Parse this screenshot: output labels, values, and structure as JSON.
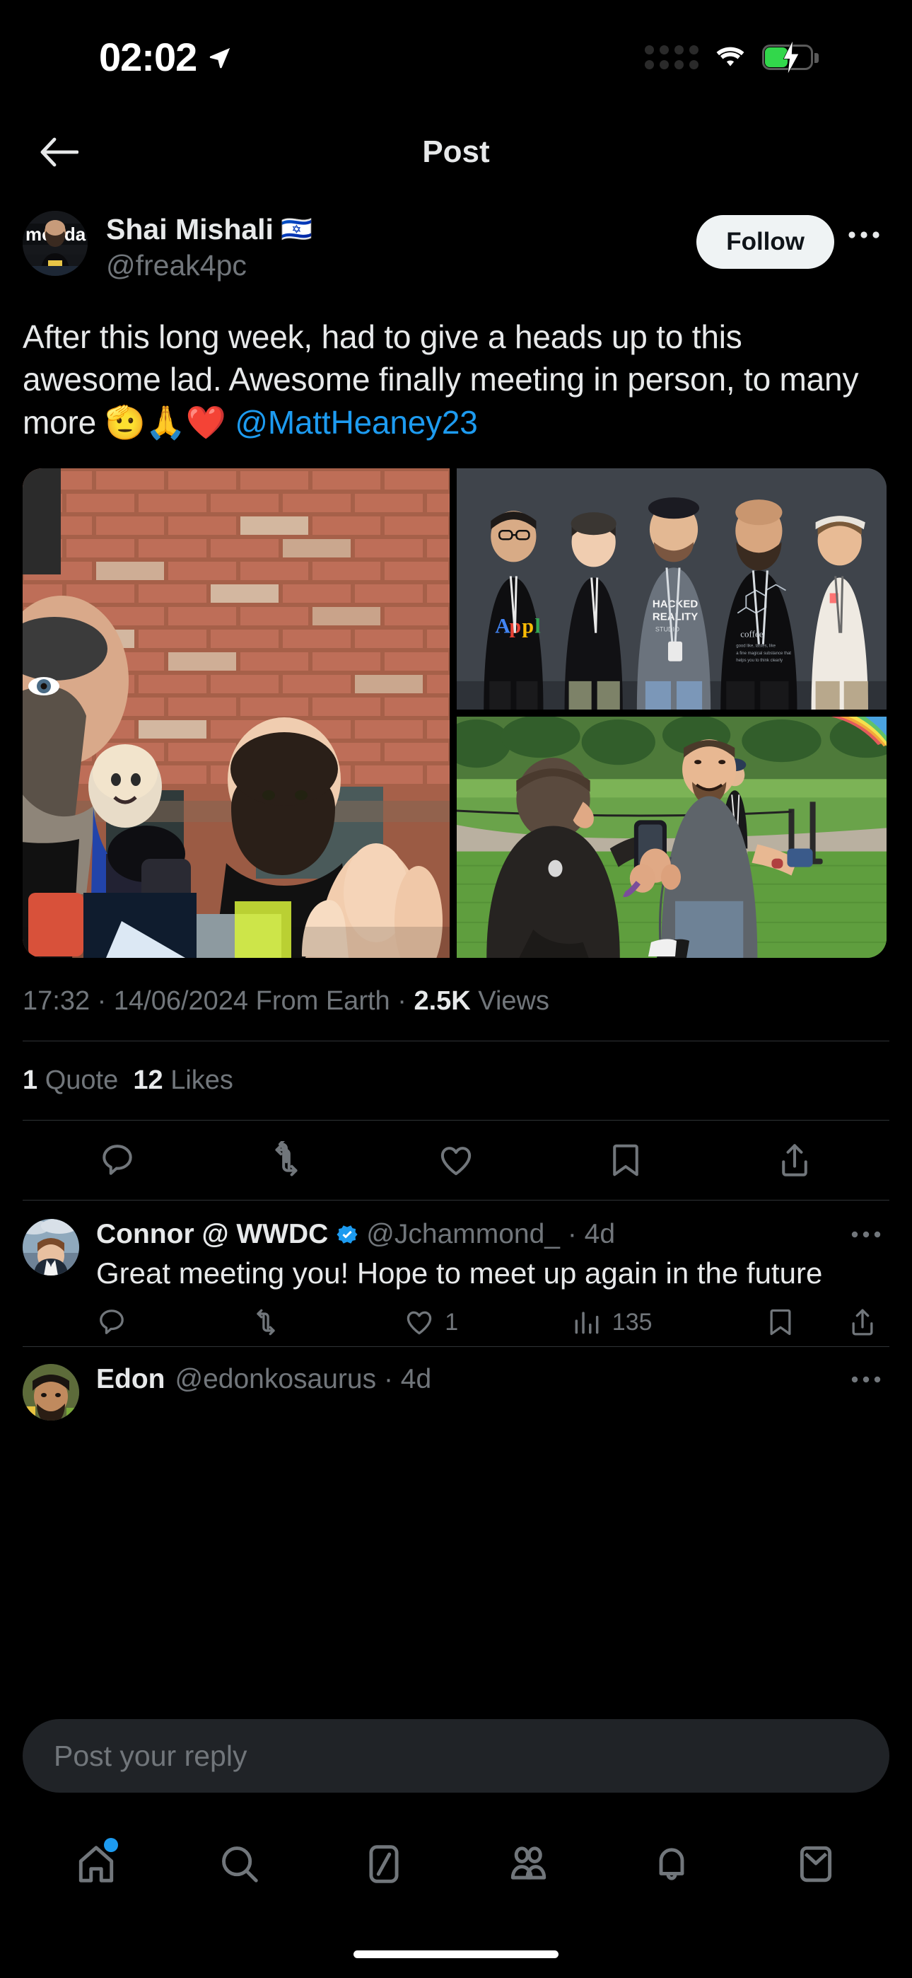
{
  "status_bar": {
    "time": "02:02",
    "location_icon": "location-arrow-icon",
    "signal_icon": "signal-dots-icon",
    "wifi_icon": "wifi-icon",
    "battery_icon": "battery-charging-icon",
    "battery_level_percent": 44,
    "battery_color": "#32d74b"
  },
  "header": {
    "back_icon": "back-arrow-icon",
    "title": "Post"
  },
  "post": {
    "author": {
      "display_name": "Shai Mishali",
      "flag": "🇮🇱",
      "handle": "@freak4pc",
      "avatar_alt": "avatar"
    },
    "follow_label": "Follow",
    "more_icon": "more-horizontal-icon",
    "text_line1": "After this long week, had to give a heads up to this",
    "text_line2": "awesome lad. Awesome finally meeting in person,",
    "text_line3_prefix": "to many more ",
    "text_emojis": "🫡🙏❤️ ",
    "mention": "@MattHeaney23",
    "media": [
      {
        "name": "photo-brick-wall-selfie",
        "position": "left"
      },
      {
        "name": "photo-group-five-people",
        "position": "right-top"
      },
      {
        "name": "photo-park-phone",
        "position": "right-bottom"
      }
    ],
    "timestamp": "17:32",
    "separator": " · ",
    "date": "14/06/2024",
    "source": "From Earth",
    "views_count": "2.5K",
    "views_label": "Views",
    "quote_count": "1",
    "quote_label": "Quote",
    "like_count": "12",
    "like_label": "Likes",
    "actions": [
      {
        "name": "reply-icon",
        "label": ""
      },
      {
        "name": "retweet-icon",
        "label": ""
      },
      {
        "name": "like-icon",
        "label": ""
      },
      {
        "name": "bookmark-icon",
        "label": ""
      },
      {
        "name": "share-icon",
        "label": ""
      }
    ]
  },
  "replies": [
    {
      "display_name": "Connor @ WWDC",
      "verified": true,
      "handle": "@Jchammond_",
      "time": "· 4d",
      "text": "Great meeting you! Hope to meet up again in the future",
      "more_icon": "more-horizontal-icon",
      "actions": {
        "reply_count": "",
        "retweet_count": "",
        "like_count": "1",
        "views_count": "135",
        "bookmark": "",
        "share": ""
      }
    },
    {
      "display_name": "Edon",
      "verified": false,
      "handle": "@edonkosaurus",
      "time": "· 4d",
      "text": "",
      "more_icon": "more-horizontal-icon"
    }
  ],
  "composer": {
    "placeholder": "Post your reply",
    "value": ""
  },
  "bottom_nav": [
    {
      "name": "home-icon",
      "badge": true
    },
    {
      "name": "search-icon",
      "badge": false
    },
    {
      "name": "grok-icon",
      "badge": false
    },
    {
      "name": "communities-icon",
      "badge": false
    },
    {
      "name": "notifications-icon",
      "badge": false
    },
    {
      "name": "messages-icon",
      "badge": false
    }
  ],
  "colors": {
    "background": "#000000",
    "text_primary": "#e7e9ea",
    "text_secondary": "#71767b",
    "accent": "#1d9bf0",
    "divider": "#2f3336",
    "follow_bg": "#eff3f4"
  }
}
